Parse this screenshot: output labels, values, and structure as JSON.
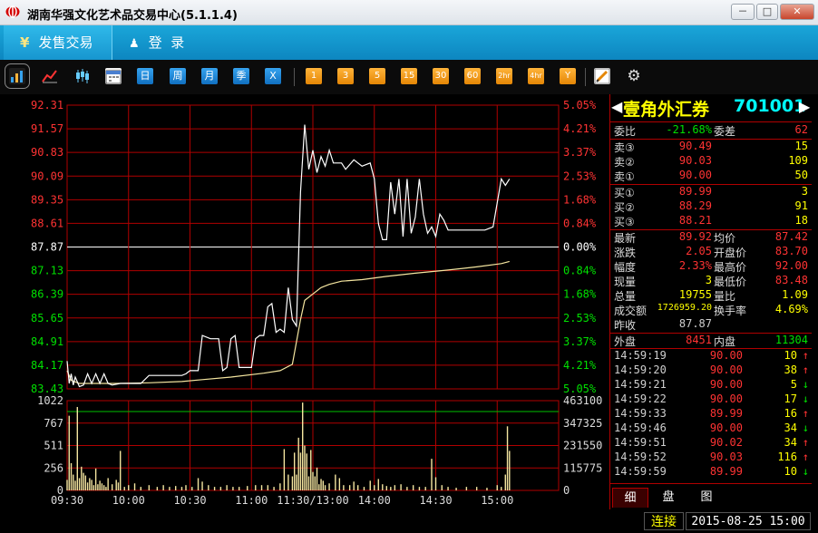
{
  "window": {
    "title": "湖南华强文化艺术品交易中心(5.1.1.4)",
    "minimize": "－",
    "maximize": "□",
    "close": "✕"
  },
  "nav": {
    "tabs": [
      {
        "icon": "yen-icon",
        "icon_glyph": "¥",
        "label": "发售交易"
      },
      {
        "icon": "user-icon",
        "icon_glyph": "♟",
        "label": "登  录"
      }
    ]
  },
  "toolbar": {
    "icons": [
      "bar-chart-icon",
      "line-chart-icon",
      "candlestick-icon",
      "calendar-icon",
      "gear-icon",
      "pen-icon"
    ],
    "period_buttons": [
      "日",
      "周",
      "月",
      "季",
      "X"
    ],
    "minute_buttons": [
      "1",
      "3",
      "5",
      "15",
      "30",
      "60",
      "2hr",
      "4hr",
      "Y"
    ]
  },
  "security": {
    "name": "壹角外汇券",
    "code": "701001",
    "prev_arrow": "◀",
    "next_arrow": "▶"
  },
  "weibi": {
    "label": "委比",
    "value": "-21.68%",
    "label2": "委差",
    "value2": "62"
  },
  "asks": [
    {
      "label": "卖③",
      "price": "90.49",
      "vol": "15"
    },
    {
      "label": "卖②",
      "price": "90.03",
      "vol": "109"
    },
    {
      "label": "卖①",
      "price": "90.00",
      "vol": "50"
    }
  ],
  "bids": [
    {
      "label": "买①",
      "price": "89.99",
      "vol": "3"
    },
    {
      "label": "买②",
      "price": "88.29",
      "vol": "91"
    },
    {
      "label": "买③",
      "price": "88.21",
      "vol": "18"
    }
  ],
  "stats": [
    {
      "l1": "最新",
      "v1": "89.92",
      "l2": "均价",
      "v2": "87.42"
    },
    {
      "l1": "涨跌",
      "v1": "2.05",
      "l2": "开盘价",
      "v2": "83.70"
    },
    {
      "l1": "幅度",
      "v1": "2.33%",
      "l2": "最高价",
      "v2": "92.00"
    },
    {
      "l1": "现量",
      "v1": "3",
      "l2": "最低价",
      "v2": "83.48"
    },
    {
      "l1": "总量",
      "v1": "19755",
      "l2": "量比",
      "v2": "1.09"
    },
    {
      "l1": "成交额",
      "v1": "1726959.20",
      "l2": "换手率",
      "v2": "4.69%"
    },
    {
      "l1": "昨收",
      "v1": "87.87",
      "l2": "",
      "v2": ""
    }
  ],
  "outer_inner": {
    "l1": "外盘",
    "v1": "8451",
    "l2": "内盘",
    "v2": "11304"
  },
  "ticks": [
    {
      "time": "14:59:19",
      "price": "90.00",
      "vol": "10",
      "dir": "↑",
      "up": true
    },
    {
      "time": "14:59:20",
      "price": "90.00",
      "vol": "38",
      "dir": "↑",
      "up": true
    },
    {
      "time": "14:59:21",
      "price": "90.00",
      "vol": "5",
      "dir": "↓",
      "up": false
    },
    {
      "time": "14:59:22",
      "price": "90.00",
      "vol": "17",
      "dir": "↓",
      "up": false
    },
    {
      "time": "14:59:33",
      "price": "89.99",
      "vol": "16",
      "dir": "↑",
      "up": true
    },
    {
      "time": "14:59:46",
      "price": "90.00",
      "vol": "34",
      "dir": "↓",
      "up": false
    },
    {
      "time": "14:59:51",
      "price": "90.02",
      "vol": "34",
      "dir": "↑",
      "up": true
    },
    {
      "time": "14:59:52",
      "price": "90.03",
      "vol": "116",
      "dir": "↑",
      "up": true
    },
    {
      "time": "14:59:59",
      "price": "89.99",
      "vol": "10",
      "dir": "↓",
      "up": false
    }
  ],
  "panel_tabs": [
    "细",
    "盘",
    "图"
  ],
  "status": {
    "connection": "连接",
    "datetime": "2015-08-25 15:00"
  },
  "colors": {
    "up": "#ff3333",
    "down": "#00e000",
    "grid": "#b00000",
    "price_line": "#ffffff",
    "avg_line": "#f5e6a0",
    "volume": "#f5e6a0"
  },
  "chart_data": {
    "type": "line",
    "price_ticks_left": [
      "92.31",
      "91.57",
      "90.83",
      "90.09",
      "89.35",
      "88.61",
      "87.87",
      "87.13",
      "86.39",
      "85.65",
      "84.91",
      "84.17",
      "83.43"
    ],
    "pct_ticks_right": [
      "5.05%",
      "4.21%",
      "3.37%",
      "2.53%",
      "1.68%",
      "0.84%",
      "0.00%",
      "0.84%",
      "1.68%",
      "2.53%",
      "3.37%",
      "4.21%",
      "5.05%"
    ],
    "prev_close": 87.87,
    "ylim": [
      83.43,
      92.31
    ],
    "volume_ticks_left": [
      "1022",
      "767",
      "511",
      "256",
      "0"
    ],
    "volume_ticks_right": [
      "463100",
      "347325",
      "231550",
      "115775",
      "0"
    ],
    "volume_ylim": [
      0,
      1022
    ],
    "x_labels": [
      "09:30",
      "10:00",
      "10:30",
      "11:00",
      "11:30/13:00",
      "14:00",
      "14:30",
      "15:00"
    ],
    "session_minutes": 240,
    "price_series": [
      [
        0,
        84.3
      ],
      [
        1,
        83.6
      ],
      [
        2,
        83.9
      ],
      [
        3,
        83.55
      ],
      [
        4,
        83.8
      ],
      [
        6,
        83.5
      ],
      [
        8,
        83.55
      ],
      [
        10,
        83.9
      ],
      [
        12,
        83.6
      ],
      [
        14,
        83.9
      ],
      [
        16,
        83.6
      ],
      [
        18,
        83.9
      ],
      [
        20,
        83.6
      ],
      [
        22,
        83.55
      ],
      [
        26,
        83.6
      ],
      [
        30,
        83.6
      ],
      [
        36,
        83.6
      ],
      [
        40,
        83.85
      ],
      [
        44,
        83.85
      ],
      [
        50,
        83.85
      ],
      [
        56,
        83.85
      ],
      [
        58,
        83.9
      ],
      [
        60,
        84.0
      ],
      [
        64,
        84.0
      ],
      [
        66,
        85.1
      ],
      [
        70,
        85.0
      ],
      [
        74,
        85.0
      ],
      [
        76,
        84.0
      ],
      [
        78,
        84.1
      ],
      [
        80,
        85.0
      ],
      [
        82,
        85.1
      ],
      [
        84,
        84.1
      ],
      [
        86,
        84.1
      ],
      [
        90,
        84.1
      ],
      [
        92,
        85.0
      ],
      [
        94,
        85.1
      ],
      [
        96,
        85.1
      ],
      [
        98,
        86.0
      ],
      [
        100,
        86.1
      ],
      [
        102,
        85.2
      ],
      [
        104,
        85.3
      ],
      [
        106,
        85.2
      ],
      [
        108,
        86.6
      ],
      [
        110,
        85.6
      ],
      [
        112,
        85.4
      ],
      [
        114,
        89.6
      ],
      [
        116,
        91.7
      ],
      [
        118,
        90.3
      ],
      [
        120,
        90.9
      ],
      [
        122,
        90.2
      ],
      [
        124,
        90.7
      ],
      [
        126,
        90.4
      ],
      [
        128,
        90.9
      ],
      [
        130,
        90.5
      ],
      [
        132,
        90.5
      ],
      [
        134,
        90.5
      ],
      [
        136,
        90.3
      ],
      [
        140,
        90.6
      ],
      [
        144,
        90.4
      ],
      [
        148,
        90.5
      ],
      [
        150,
        90.0
      ],
      [
        152,
        88.6
      ],
      [
        154,
        88.1
      ],
      [
        156,
        88.1
      ],
      [
        158,
        89.9
      ],
      [
        160,
        88.9
      ],
      [
        162,
        90.0
      ],
      [
        164,
        88.2
      ],
      [
        166,
        90.0
      ],
      [
        168,
        88.3
      ],
      [
        170,
        88.8
      ],
      [
        172,
        90.0
      ],
      [
        174,
        88.9
      ],
      [
        176,
        88.3
      ],
      [
        178,
        88.5
      ],
      [
        180,
        88.2
      ],
      [
        182,
        88.9
      ],
      [
        184,
        88.7
      ],
      [
        186,
        88.4
      ],
      [
        190,
        88.4
      ],
      [
        200,
        88.4
      ],
      [
        204,
        88.4
      ],
      [
        208,
        88.5
      ],
      [
        212,
        90.0
      ],
      [
        214,
        89.8
      ],
      [
        216,
        90.0
      ]
    ],
    "avg_series": [
      [
        0,
        84.0
      ],
      [
        2,
        83.7
      ],
      [
        6,
        83.6
      ],
      [
        14,
        83.6
      ],
      [
        24,
        83.6
      ],
      [
        40,
        83.62
      ],
      [
        56,
        83.66
      ],
      [
        66,
        83.72
      ],
      [
        80,
        83.8
      ],
      [
        96,
        83.92
      ],
      [
        104,
        84.0
      ],
      [
        110,
        84.2
      ],
      [
        114,
        85.6
      ],
      [
        116,
        86.2
      ],
      [
        120,
        86.4
      ],
      [
        124,
        86.6
      ],
      [
        128,
        86.7
      ],
      [
        134,
        86.8
      ],
      [
        144,
        86.85
      ],
      [
        156,
        86.95
      ],
      [
        170,
        87.05
      ],
      [
        186,
        87.15
      ],
      [
        200,
        87.25
      ],
      [
        212,
        87.35
      ],
      [
        216,
        87.42
      ]
    ],
    "volume_bars": [
      [
        0,
        120
      ],
      [
        1,
        850
      ],
      [
        2,
        310
      ],
      [
        3,
        180
      ],
      [
        4,
        110
      ],
      [
        5,
        950
      ],
      [
        6,
        140
      ],
      [
        7,
        270
      ],
      [
        8,
        200
      ],
      [
        9,
        170
      ],
      [
        10,
        90
      ],
      [
        11,
        140
      ],
      [
        12,
        120
      ],
      [
        13,
        60
      ],
      [
        14,
        250
      ],
      [
        15,
        70
      ],
      [
        16,
        110
      ],
      [
        17,
        80
      ],
      [
        18,
        60
      ],
      [
        19,
        40
      ],
      [
        20,
        140
      ],
      [
        22,
        70
      ],
      [
        24,
        120
      ],
      [
        25,
        90
      ],
      [
        26,
        450
      ],
      [
        28,
        40
      ],
      [
        30,
        60
      ],
      [
        33,
        80
      ],
      [
        36,
        40
      ],
      [
        40,
        60
      ],
      [
        44,
        40
      ],
      [
        47,
        60
      ],
      [
        50,
        40
      ],
      [
        53,
        50
      ],
      [
        56,
        40
      ],
      [
        58,
        60
      ],
      [
        61,
        40
      ],
      [
        64,
        140
      ],
      [
        66,
        100
      ],
      [
        69,
        60
      ],
      [
        72,
        40
      ],
      [
        75,
        40
      ],
      [
        78,
        60
      ],
      [
        81,
        40
      ],
      [
        84,
        40
      ],
      [
        88,
        50
      ],
      [
        92,
        60
      ],
      [
        95,
        60
      ],
      [
        98,
        60
      ],
      [
        101,
        40
      ],
      [
        104,
        80
      ],
      [
        106,
        470
      ],
      [
        108,
        180
      ],
      [
        110,
        160
      ],
      [
        111,
        430
      ],
      [
        112,
        180
      ],
      [
        113,
        600
      ],
      [
        114,
        430
      ],
      [
        115,
        1000
      ],
      [
        116,
        510
      ],
      [
        117,
        420
      ],
      [
        118,
        160
      ],
      [
        119,
        460
      ],
      [
        120,
        210
      ],
      [
        121,
        160
      ],
      [
        122,
        260
      ],
      [
        123,
        70
      ],
      [
        124,
        130
      ],
      [
        125,
        110
      ],
      [
        126,
        60
      ],
      [
        128,
        80
      ],
      [
        131,
        180
      ],
      [
        133,
        140
      ],
      [
        135,
        60
      ],
      [
        138,
        60
      ],
      [
        140,
        100
      ],
      [
        142,
        60
      ],
      [
        145,
        40
      ],
      [
        148,
        110
      ],
      [
        150,
        60
      ],
      [
        152,
        130
      ],
      [
        154,
        70
      ],
      [
        156,
        50
      ],
      [
        158,
        40
      ],
      [
        160,
        60
      ],
      [
        163,
        70
      ],
      [
        166,
        40
      ],
      [
        169,
        60
      ],
      [
        172,
        40
      ],
      [
        175,
        40
      ],
      [
        178,
        360
      ],
      [
        180,
        150
      ],
      [
        183,
        60
      ],
      [
        186,
        40
      ],
      [
        190,
        30
      ],
      [
        195,
        40
      ],
      [
        200,
        40
      ],
      [
        205,
        30
      ],
      [
        210,
        60
      ],
      [
        212,
        40
      ],
      [
        214,
        180
      ],
      [
        215,
        730
      ],
      [
        216,
        450
      ]
    ]
  }
}
